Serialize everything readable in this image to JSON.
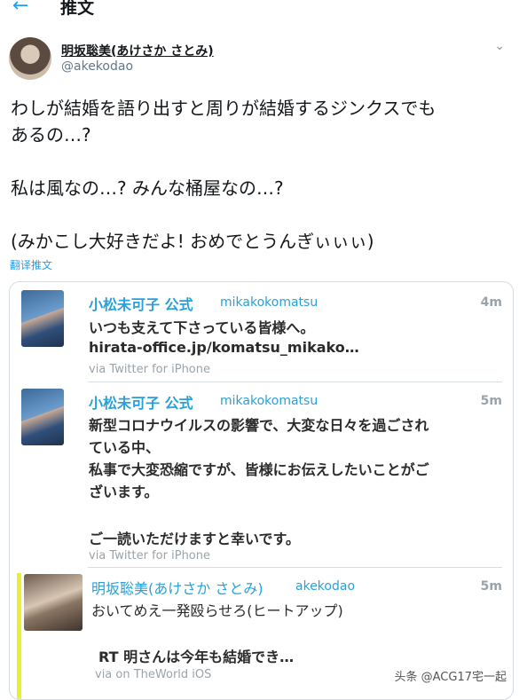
{
  "header": {
    "back_icon": "←",
    "title": "推文"
  },
  "author": {
    "name": "明坂聡美(あけさか さとみ)",
    "handle": "@akekodao"
  },
  "tweet": {
    "lines": [
      "わしが結婚を語り出すと周りが結婚するジンクスでも",
      "あるの…?",
      "私は風なの…? みんな桶屋なの…?",
      "(みかこし大好きだよ! おめでとうんぎぃぃぃ)"
    ],
    "translate_label": "翻译推文"
  },
  "embed": [
    {
      "name": "小松未可子 公式",
      "handle": "mikakokomatsu",
      "time": "4m",
      "lines": [
        "いつも支えて下さっている皆様へ。",
        "hirata-office.jp/komatsu_mikako…"
      ],
      "via": "via Twitter for iPhone"
    },
    {
      "name": "小松未可子 公式",
      "handle": "mikakokomatsu",
      "time": "5m",
      "lines": [
        "新型コロナウイルスの影響で、大変な日々を過ごされ",
        "ている中、",
        "私事で大変恐縮ですが、皆様にお伝えしたいことがご",
        "ざいます。",
        "ご一読いただけますと幸いです。"
      ],
      "via": "via Twitter for iPhone"
    },
    {
      "name": "明坂聡美(あけさか さとみ)",
      "handle": "akekodao",
      "time": "5m",
      "lines": [
        "おいてめえ一発殴らせろ(ヒートアップ)",
        "RT 明さんは今年も結婚でき…"
      ],
      "via": "via on TheWorld iOS"
    }
  ],
  "watermark": "头条 @ACG17宅一起",
  "colors": {
    "accent": "#1da1f2",
    "embed_name": "#29a0d8",
    "highlight_bar": "#e8f030"
  }
}
